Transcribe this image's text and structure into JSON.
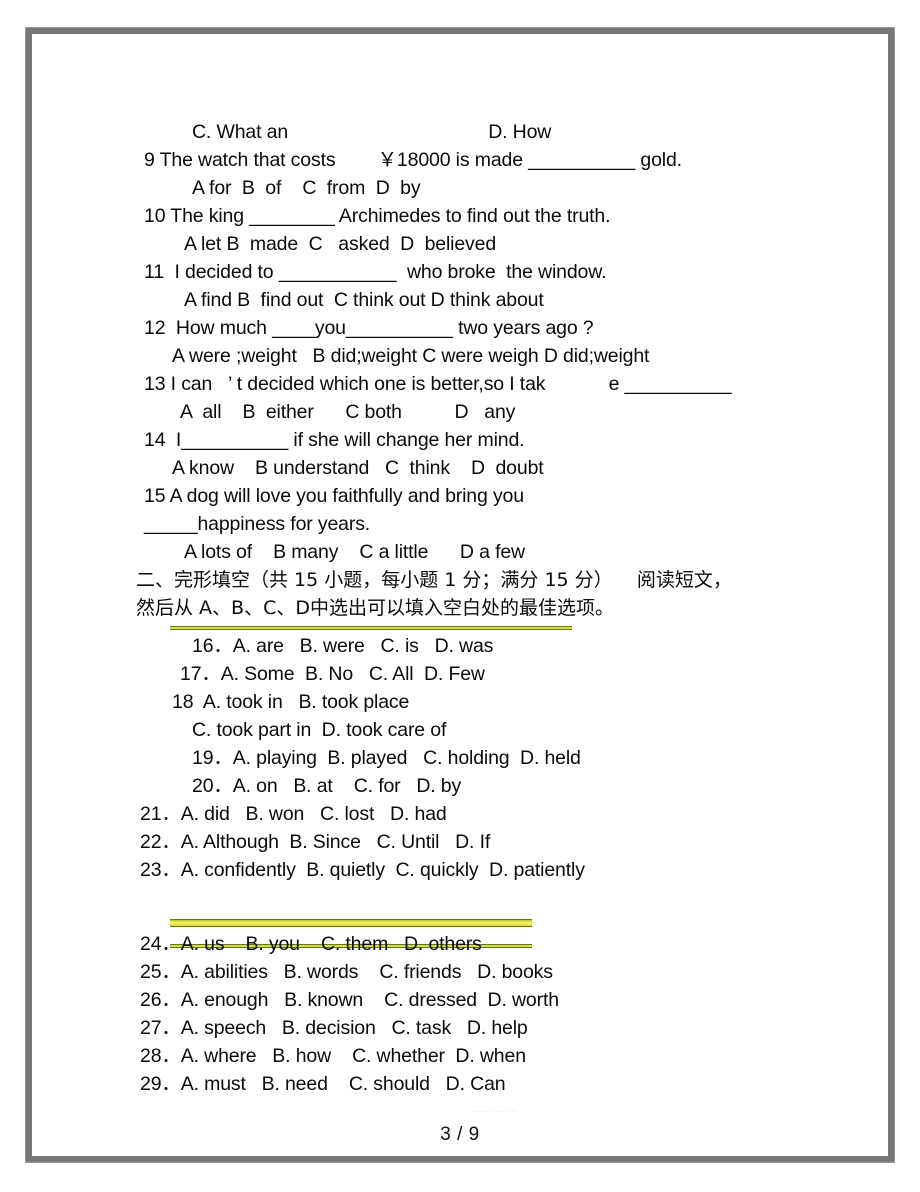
{
  "document": {
    "page_number": "3 / 9",
    "watermark_top": "· ··",
    "watermark_bottom": "· ··· ···· ·· ··· ···"
  },
  "section_one": {
    "lines": [
      {
        "id": "q8-options",
        "text": "C. What an                                      D. How"
      },
      {
        "id": "q9-stem",
        "text": "9 The watch that costs        ￥18000 is made __________ gold."
      },
      {
        "id": "q9-options",
        "text": "A for  B  of    C  from  D  by"
      },
      {
        "id": "q10-stem",
        "text": "10 The king ________ Archimedes to find out the truth."
      },
      {
        "id": "q10-options",
        "text": "A let B  made  C   asked  D  believed"
      },
      {
        "id": "q11-stem",
        "text": "11  I decided to ___________  who broke  the window."
      },
      {
        "id": "q11-options",
        "text": "A find B  find out  C think out D think about"
      },
      {
        "id": "q12-stem",
        "text": "12  How much ____you__________ two years ago ?"
      },
      {
        "id": "q12-options",
        "text": "A were ;weight   B did;weight C were weigh D did;weight"
      },
      {
        "id": "q13-stem",
        "text": "13 I can   ’ t decided which one is better,so I tak            e __________"
      },
      {
        "id": "q13-options",
        "text": "A  all    B  either      C both          D   any"
      },
      {
        "id": "q14-stem",
        "text": "14  I__________ if she will change her mind."
      },
      {
        "id": "q14-options",
        "text": "A know    B understand   C  think    D  doubt"
      },
      {
        "id": "q15-stem",
        "text": "15 A dog will love you faithfully and bring you"
      },
      {
        "id": "q15-stem2",
        "text": "_____happiness for years."
      },
      {
        "id": "q15-options",
        "text": "A lots of    B many    C a little      D a few"
      }
    ]
  },
  "section_two": {
    "heading_line1": "二、完形填空（共 15 小题，每小题 1 分；满分 15 分）    阅读短文，",
    "heading_line2": "然后从 A、B、C、D中选出可以填入空白处的最佳选项。",
    "questions": [
      {
        "id": "q16",
        "text": "16．A. are   B. were   C. is   D. was"
      },
      {
        "id": "q17",
        "text": "17．A. Some  B. No   C. All  D. Few"
      },
      {
        "id": "q18",
        "text": "18  A. took in   B. took place"
      },
      {
        "id": "q18b",
        "text": "C. took part in  D. took care of"
      },
      {
        "id": "q19",
        "text": "19．A. playing  B. played   C. holding  D. held"
      },
      {
        "id": "q20",
        "text": "20．A. on   B. at    C. for   D. by"
      },
      {
        "id": "q21",
        "text": "21．A. did   B. won   C. lost   D. had"
      },
      {
        "id": "q22",
        "text": "22．A. Although  B. Since   C. Until   D. If"
      },
      {
        "id": "q23",
        "text": "23．A. confidently  B. quietly  C. quickly  D. patiently"
      },
      {
        "id": "q24",
        "text": "24．A. us    B. you    C. them   D. others"
      },
      {
        "id": "q25",
        "text": "25．A. abilities   B. words    C. friends   D. books"
      },
      {
        "id": "q26",
        "text": "26．A. enough   B. known    C. dressed  D. worth"
      },
      {
        "id": "q27",
        "text": "27．A. speech   B. decision   C. task   D. help"
      },
      {
        "id": "q28",
        "text": "28．A. where   B. how    C. whether  D. when"
      },
      {
        "id": "q29",
        "text": "29．A. must   B. need    C. should   D. Can"
      }
    ]
  },
  "highlights": [
    {
      "id": "highlight-above-q16",
      "style": "thin"
    },
    {
      "id": "highlight-between-q23-q24-upper",
      "style": "thick"
    },
    {
      "id": "highlight-between-q23-q24-lower",
      "style": "thin"
    }
  ],
  "colors": {
    "highlight_yellow": "#f3ec5c",
    "highlight_green": "#5e7c16",
    "frame_gray": "#777777",
    "text_black": "#0b0b0b"
  }
}
